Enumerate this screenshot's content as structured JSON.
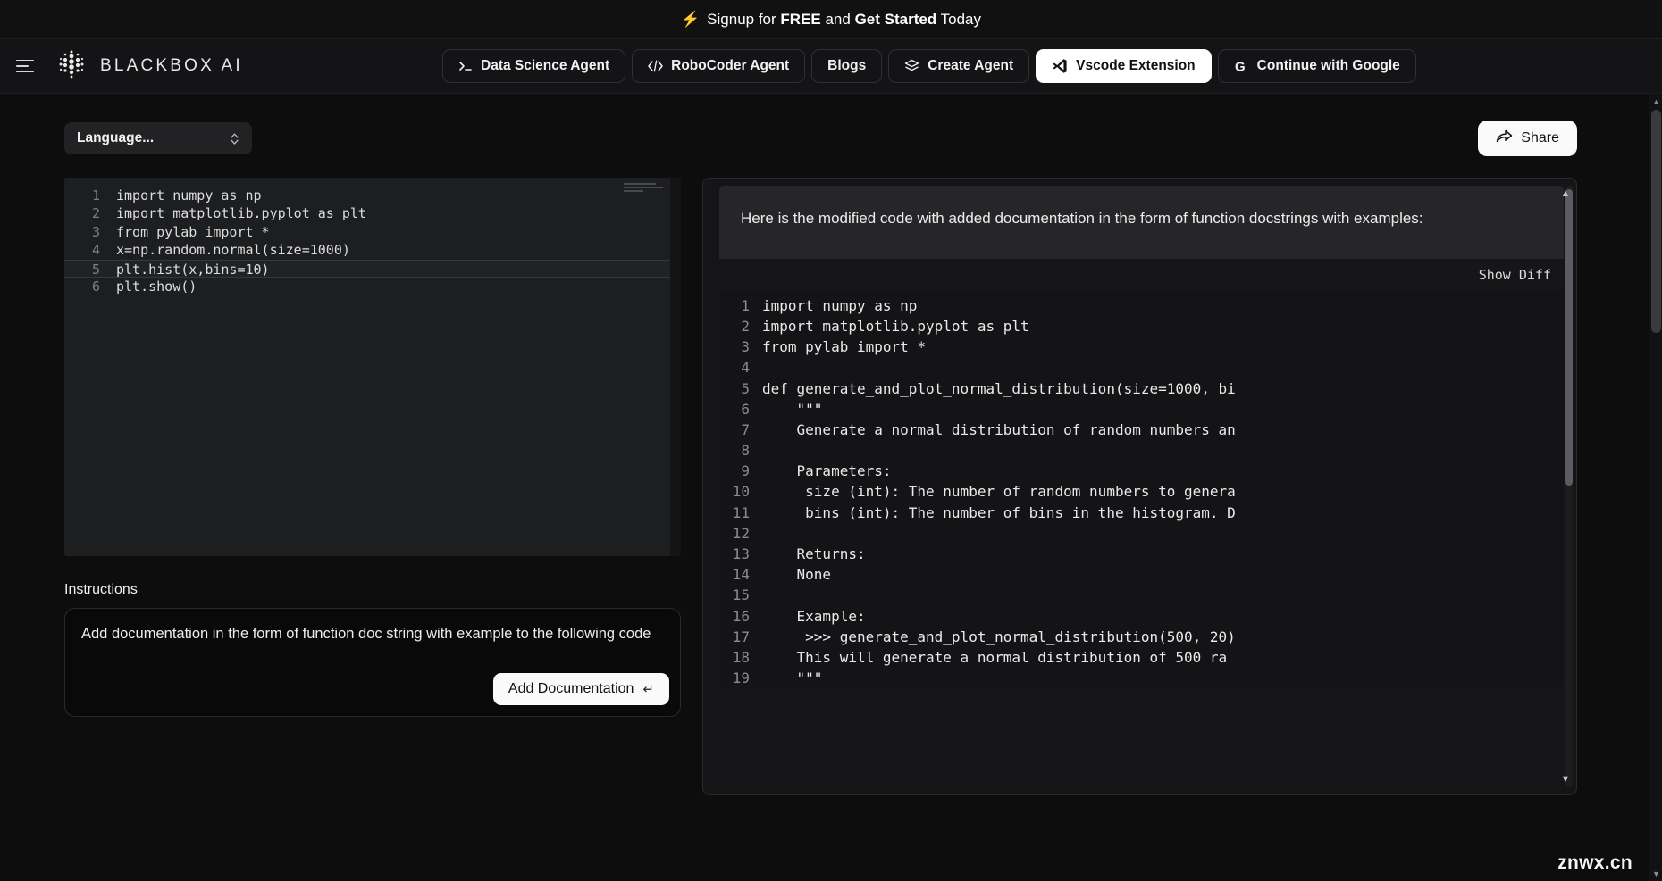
{
  "banner": {
    "icon": "lightning-bolt-icon",
    "prefix": "Signup for ",
    "bold1": "FREE",
    "middle": " and ",
    "bold2": "Get Started",
    "suffix": " Today"
  },
  "header": {
    "menu_icon": "hamburger-menu-icon",
    "logo_icon": "blackbox-dots-logo-icon",
    "brand": "BLACKBOX AI",
    "nav": [
      {
        "label": "Data Science Agent",
        "icon": "terminal-prompt-icon",
        "active": false,
        "bordered": true
      },
      {
        "label": "RoboCoder Agent",
        "icon": "code-brackets-icon",
        "active": false,
        "bordered": true
      },
      {
        "label": "Blogs",
        "icon": "",
        "active": false,
        "bordered": true
      },
      {
        "label": "Create Agent",
        "icon": "layers-stack-icon",
        "active": false,
        "bordered": true
      },
      {
        "label": "Vscode Extension",
        "icon": "vscode-icon",
        "active": true,
        "bordered": true
      },
      {
        "label": "Continue with Google",
        "icon": "google-g-icon",
        "active": false,
        "bordered": true
      }
    ]
  },
  "toolbar": {
    "language_select_value": "Language...",
    "language_select_icon": "chevron-up-down-icon",
    "share_label": "Share",
    "share_icon": "share-arrow-icon"
  },
  "editor": {
    "lines": [
      {
        "n": "1",
        "text": "import numpy as np",
        "highlight": false
      },
      {
        "n": "2",
        "text": "import matplotlib.pyplot as plt",
        "highlight": false
      },
      {
        "n": "3",
        "text": "from pylab import *",
        "highlight": false
      },
      {
        "n": "4",
        "text": "x=np.random.normal(size=1000)",
        "highlight": false
      },
      {
        "n": "5",
        "text": "plt.hist(x,bins=10)",
        "highlight": true
      },
      {
        "n": "6",
        "text": "plt.show()",
        "highlight": false
      }
    ]
  },
  "instructions": {
    "label": "Instructions",
    "value": "Add documentation in the form of function doc string with example to the following code",
    "placeholder": "Add documentation in the form of function doc string with example to the following code",
    "submit_label": "Add Documentation",
    "submit_icon": "return-enter-arrow-icon"
  },
  "response": {
    "intro": "Here is the modified code with added documentation in the form of function docstrings with examples:",
    "show_diff_label": "Show Diff",
    "lines": [
      {
        "n": "1",
        "text": "import numpy as np"
      },
      {
        "n": "2",
        "text": "import matplotlib.pyplot as plt"
      },
      {
        "n": "3",
        "text": "from pylab import *"
      },
      {
        "n": "4",
        "text": ""
      },
      {
        "n": "5",
        "text": "def generate_and_plot_normal_distribution(size=1000, bi"
      },
      {
        "n": "6",
        "text": "    \"\"\""
      },
      {
        "n": "7",
        "text": "    Generate a normal distribution of random numbers an"
      },
      {
        "n": "8",
        "text": ""
      },
      {
        "n": "9",
        "text": "    Parameters:"
      },
      {
        "n": "10",
        "text": "     size (int): The number of random numbers to genera"
      },
      {
        "n": "11",
        "text": "     bins (int): The number of bins in the histogram. D"
      },
      {
        "n": "12",
        "text": ""
      },
      {
        "n": "13",
        "text": "    Returns:"
      },
      {
        "n": "14",
        "text": "    None"
      },
      {
        "n": "15",
        "text": ""
      },
      {
        "n": "16",
        "text": "    Example:"
      },
      {
        "n": "17",
        "text": "     >>> generate_and_plot_normal_distribution(500, 20)"
      },
      {
        "n": "18",
        "text": "    This will generate a normal distribution of 500 ra"
      },
      {
        "n": "19",
        "text": "    \"\"\""
      }
    ]
  },
  "watermark": "znwx.cn",
  "colors": {
    "page_bg": "#0d0d0d",
    "header_bg": "#141416",
    "accent_white": "#ffffff",
    "bolt_yellow": "#f6c343",
    "editor_bg": "#1d1e20",
    "response_bg": "#151517"
  }
}
